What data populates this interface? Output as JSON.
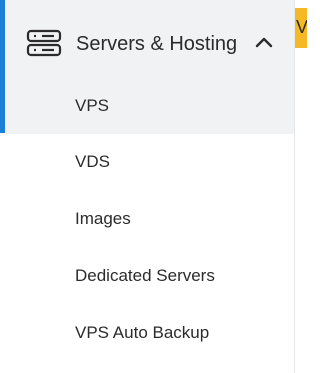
{
  "sidebar": {
    "section": {
      "icon": "server-rack-icon",
      "label": "Servers & Hosting",
      "expanded": true,
      "toggle_icon": "chevron-up-icon"
    },
    "items": [
      {
        "label": "VPS",
        "active": true
      },
      {
        "label": "VDS",
        "active": false
      },
      {
        "label": "Images",
        "active": false
      },
      {
        "label": "Dedicated Servers",
        "active": false
      },
      {
        "label": "VPS Auto Backup",
        "active": false
      }
    ],
    "accent_color": "#1e7fd6"
  },
  "right_panel": {
    "banner_text": "V",
    "banner_color": "#f6b926"
  }
}
